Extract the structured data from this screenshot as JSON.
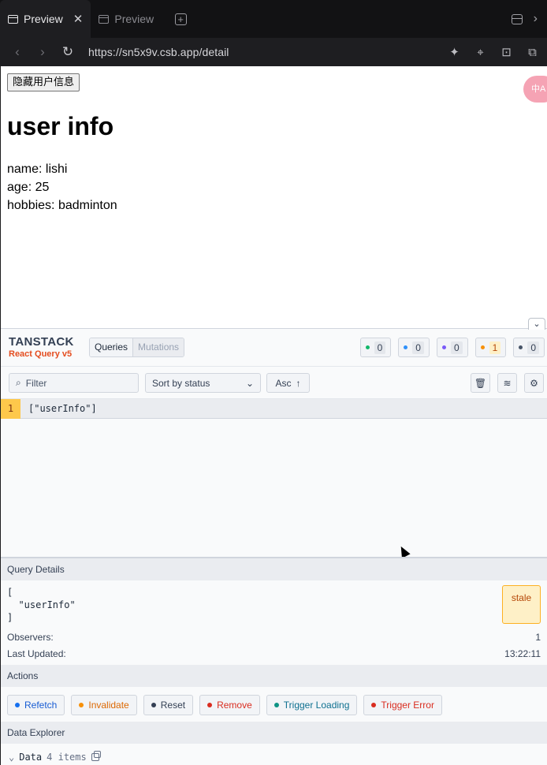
{
  "browser": {
    "tabs": [
      {
        "label": "Preview",
        "active": true
      },
      {
        "label": "Preview",
        "active": false
      }
    ],
    "url": "https://sn5x9v.csb.app/detail"
  },
  "page": {
    "hide_button": "隐藏用户信息",
    "title": "user info",
    "fields": [
      {
        "text": "name: lishi"
      },
      {
        "text": "age: 25"
      },
      {
        "text": "hobbies: badminton"
      }
    ],
    "translate_badge": "中A"
  },
  "devtools": {
    "logo_top": "TANSTACK",
    "logo_bottom": "React Query v5",
    "tabs": [
      "Queries",
      "Mutations"
    ],
    "status_counts": [
      {
        "color": "#12b76a",
        "count": "0"
      },
      {
        "color": "#2e90fa",
        "count": "0"
      },
      {
        "color": "#7a5af8",
        "count": "0"
      },
      {
        "color": "#f79009",
        "count": "1"
      },
      {
        "color": "#475467",
        "count": "0"
      }
    ],
    "filter_placeholder": "Filter",
    "sort_label": "Sort by status",
    "order_label": "Asc",
    "queries": [
      {
        "observers": "1",
        "key": "[\"userInfo\"]"
      }
    ],
    "details": {
      "heading": "Query Details",
      "key_lines": [
        "[",
        "  \"userInfo\"",
        "]"
      ],
      "status": "stale",
      "observers_label": "Observers:",
      "observers_value": "1",
      "updated_label": "Last Updated:",
      "updated_value": "13:22:11"
    },
    "actions_heading": "Actions",
    "actions": [
      {
        "label": "Refetch",
        "color": "#1570ef",
        "text_color": "#175cd3"
      },
      {
        "label": "Invalidate",
        "color": "#f79009",
        "text_color": "#dc6803"
      },
      {
        "label": "Reset",
        "color": "#344054",
        "text_color": "#344054"
      },
      {
        "label": "Remove",
        "color": "#d92d20",
        "text_color": "#d92d20"
      },
      {
        "label": "Trigger Loading",
        "color": "#0e9384",
        "text_color": "#0e7090"
      },
      {
        "label": "Trigger Error",
        "color": "#d92d20",
        "text_color": "#d92d20"
      }
    ],
    "explorer_heading": "Data Explorer",
    "data_label": "Data",
    "data_count": "4 items"
  }
}
